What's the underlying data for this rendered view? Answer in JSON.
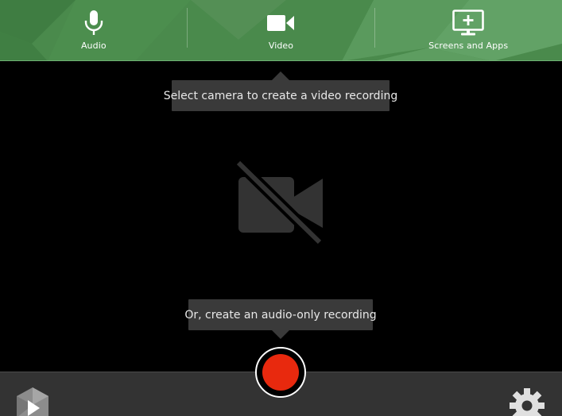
{
  "sources": {
    "audio": {
      "label": "Audio",
      "icon": "microphone-icon"
    },
    "video": {
      "label": "Video",
      "icon": "video-camera-icon"
    },
    "screens": {
      "label": "Screens and Apps",
      "icon": "monitor-plus-icon"
    }
  },
  "tooltips": {
    "video_hint": "Select camera to create a video recording",
    "audio_hint": "Or, create an audio-only recording"
  },
  "preview": {
    "icon": "camera-off-icon"
  },
  "bottom": {
    "logo_icon": "app-logo-icon",
    "settings_icon": "gear-icon",
    "record_icon": "record-icon"
  },
  "colors": {
    "topbar": "#4a8a4c",
    "record": "#e8290e",
    "tooltip_bg": "#3a3a3a",
    "bottombar": "#333333"
  }
}
